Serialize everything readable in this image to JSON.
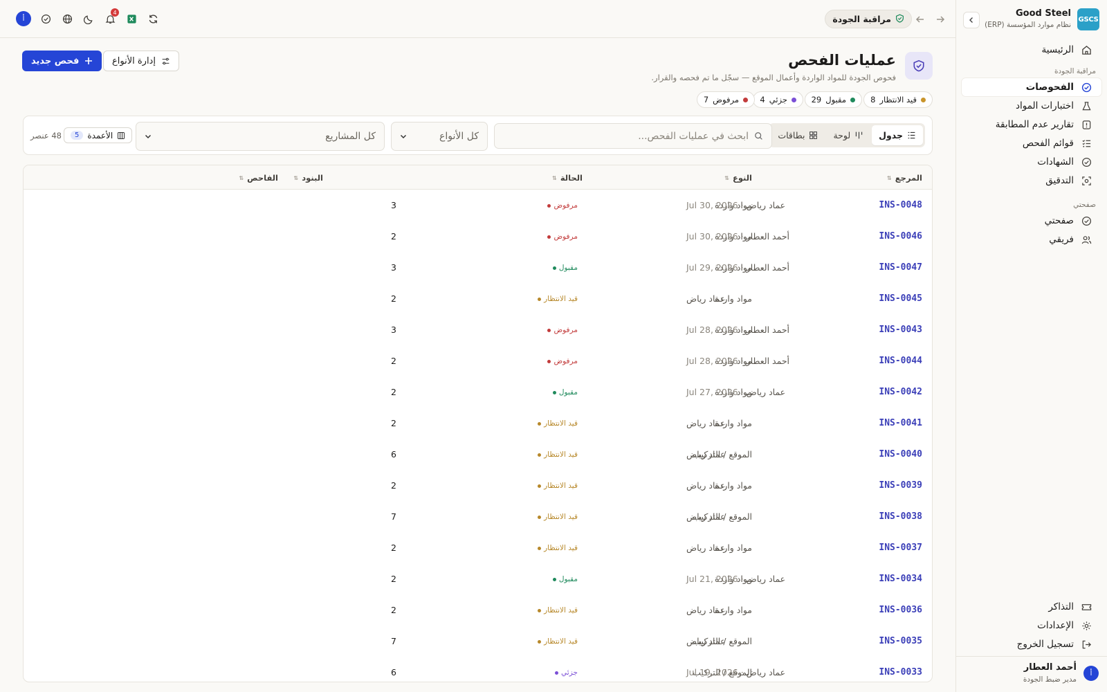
{
  "brand": {
    "name": "Good Steel",
    "subtitle": "نظام موارد المؤسسة (ERP)",
    "logo": "GSCS"
  },
  "sidebar": {
    "home": "الرئيسية",
    "section_quality": "مراقبة الجودة",
    "items": [
      {
        "label": "الفحوصات",
        "icon": "check-circle-icon",
        "active": true
      },
      {
        "label": "اختبارات المواد",
        "icon": "flask-icon",
        "active": false
      },
      {
        "label": "تقارير عدم المطابقة",
        "icon": "alert-icon",
        "active": false
      },
      {
        "label": "قوائم الفحص",
        "icon": "list-check-icon",
        "active": false
      },
      {
        "label": "الشهادات",
        "icon": "badge-icon",
        "active": false
      },
      {
        "label": "التدقيق",
        "icon": "scan-icon",
        "active": false
      }
    ],
    "section_mine": "صفحتي",
    "mine_items": [
      {
        "label": "صفحتي",
        "icon": "check-circle-icon"
      },
      {
        "label": "فريقي",
        "icon": "users-icon"
      }
    ],
    "bottom_items": [
      {
        "label": "التذاكر",
        "icon": "ticket-icon"
      },
      {
        "label": "الإعدادات",
        "icon": "gear-icon"
      },
      {
        "label": "تسجيل الخروج",
        "icon": "logout-icon"
      }
    ],
    "user": {
      "name": "أحمد العطار",
      "role": "مدير ضبط الجودة",
      "initial": "أ"
    }
  },
  "topbar": {
    "module": "مراقبة الجودة",
    "notifications": "4",
    "avatar_initial": "أ"
  },
  "page": {
    "title": "عمليات الفحص",
    "subtitle": "فحوص الجودة للمواد الواردة وأعمال الموقع — سجّل ما تم فحصه والقرار.",
    "new_button": "فحص جديد",
    "manage_button": "إدارة الأنواع"
  },
  "stats": [
    {
      "label": "قيد الانتظار",
      "count": "8",
      "color": "#c9952b"
    },
    {
      "label": "مقبول",
      "count": "29",
      "color": "#1f8a5c"
    },
    {
      "label": "جزئي",
      "count": "4",
      "color": "#7b4fd6"
    },
    {
      "label": "مرفوض",
      "count": "7",
      "color": "#c23b3b"
    }
  ],
  "toolbar": {
    "views": [
      {
        "label": "جدول",
        "icon": "table-icon",
        "active": true
      },
      {
        "label": "لوحة",
        "icon": "kanban-icon",
        "active": false
      },
      {
        "label": "بطاقات",
        "icon": "grid-icon",
        "active": false
      }
    ],
    "search_placeholder": "ابحث في عمليات الفحص...",
    "type_filter": "كل الأنواع",
    "project_filter": "كل المشاريع",
    "columns_label": "الأعمدة",
    "columns_count": "5",
    "items_count": "48 عنصر"
  },
  "table": {
    "headers": {
      "ref": "المرجع",
      "type": "النوع",
      "status": "الحالة",
      "items": "البنود",
      "inspector": "الفاحص"
    },
    "status_colors": {
      "مرفوض": "#c23b3b",
      "مقبول": "#1f8a5c",
      "قيد الانتظار": "#b7882a",
      "جزئي": "#7b4fd6"
    },
    "rows": [
      {
        "ref": "INS-0048",
        "type": "مواد واردة",
        "status": "مرفوض",
        "items": "3",
        "inspector": "عماد رياض",
        "date": "Jul 30, 2026"
      },
      {
        "ref": "INS-0046",
        "type": "مواد واردة",
        "status": "مرفوض",
        "items": "2",
        "inspector": "أحمد العطار",
        "date": "Jul 30, 2026"
      },
      {
        "ref": "INS-0047",
        "type": "مواد واردة",
        "status": "مقبول",
        "items": "3",
        "inspector": "أحمد العطار",
        "date": "Jul 29, 2026"
      },
      {
        "ref": "INS-0045",
        "type": "مواد واردة",
        "status": "قيد الانتظار",
        "items": "2",
        "inspector": "عماد رياض",
        "date": ""
      },
      {
        "ref": "INS-0043",
        "type": "مواد واردة",
        "status": "مرفوض",
        "items": "3",
        "inspector": "أحمد العطار",
        "date": "Jul 28, 2026"
      },
      {
        "ref": "INS-0044",
        "type": "مواد واردة",
        "status": "مرفوض",
        "items": "2",
        "inspector": "أحمد العطار",
        "date": "Jul 28, 2026"
      },
      {
        "ref": "INS-0042",
        "type": "مواد واردة",
        "status": "مقبول",
        "items": "2",
        "inspector": "عماد رياض",
        "date": "Jul 27, 2026"
      },
      {
        "ref": "INS-0041",
        "type": "مواد واردة",
        "status": "قيد الانتظار",
        "items": "2",
        "inspector": "عماد رياض",
        "date": ""
      },
      {
        "ref": "INS-0040",
        "type": "الموقع / التركيب",
        "status": "قيد الانتظار",
        "items": "6",
        "inspector": "عماد رياض",
        "date": ""
      },
      {
        "ref": "INS-0039",
        "type": "مواد واردة",
        "status": "قيد الانتظار",
        "items": "2",
        "inspector": "عماد رياض",
        "date": ""
      },
      {
        "ref": "INS-0038",
        "type": "الموقع / التركيب",
        "status": "قيد الانتظار",
        "items": "7",
        "inspector": "عماد رياض",
        "date": ""
      },
      {
        "ref": "INS-0037",
        "type": "مواد واردة",
        "status": "قيد الانتظار",
        "items": "2",
        "inspector": "عماد رياض",
        "date": ""
      },
      {
        "ref": "INS-0034",
        "type": "مواد واردة",
        "status": "مقبول",
        "items": "2",
        "inspector": "عماد رياض",
        "date": "Jul 21, 2026"
      },
      {
        "ref": "INS-0036",
        "type": "مواد واردة",
        "status": "قيد الانتظار",
        "items": "2",
        "inspector": "عماد رياض",
        "date": ""
      },
      {
        "ref": "INS-0035",
        "type": "الموقع / التركيب",
        "status": "قيد الانتظار",
        "items": "7",
        "inspector": "عماد رياض",
        "date": ""
      },
      {
        "ref": "INS-0033",
        "type": "الموقع / التركيب",
        "status": "جزئي",
        "items": "6",
        "inspector": "عماد رياض",
        "date": "Jul 19, 2026"
      }
    ]
  }
}
